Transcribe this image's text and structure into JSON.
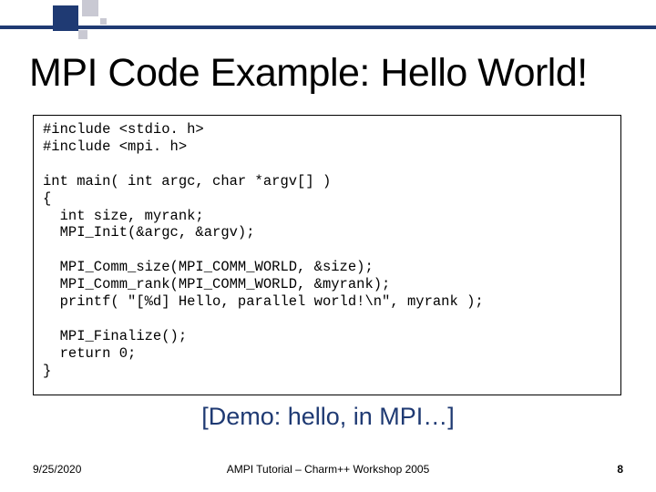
{
  "title": "MPI Code Example: Hello World!",
  "code": "#include <stdio. h>\n#include <mpi. h>\n\nint main( int argc, char *argv[] )\n{\n  int size, myrank;\n  MPI_Init(&argc, &argv);\n\n  MPI_Comm_size(MPI_COMM_WORLD, &size);\n  MPI_Comm_rank(MPI_COMM_WORLD, &myrank);\n  printf( \"[%d] Hello, parallel world!\\n\", myrank );\n\n  MPI_Finalize();\n  return 0;\n}",
  "demo": "[Demo: hello, in MPI…]",
  "date": "9/25/2020",
  "footer": "AMPI Tutorial – Charm++ Workshop 2005",
  "page": "8"
}
